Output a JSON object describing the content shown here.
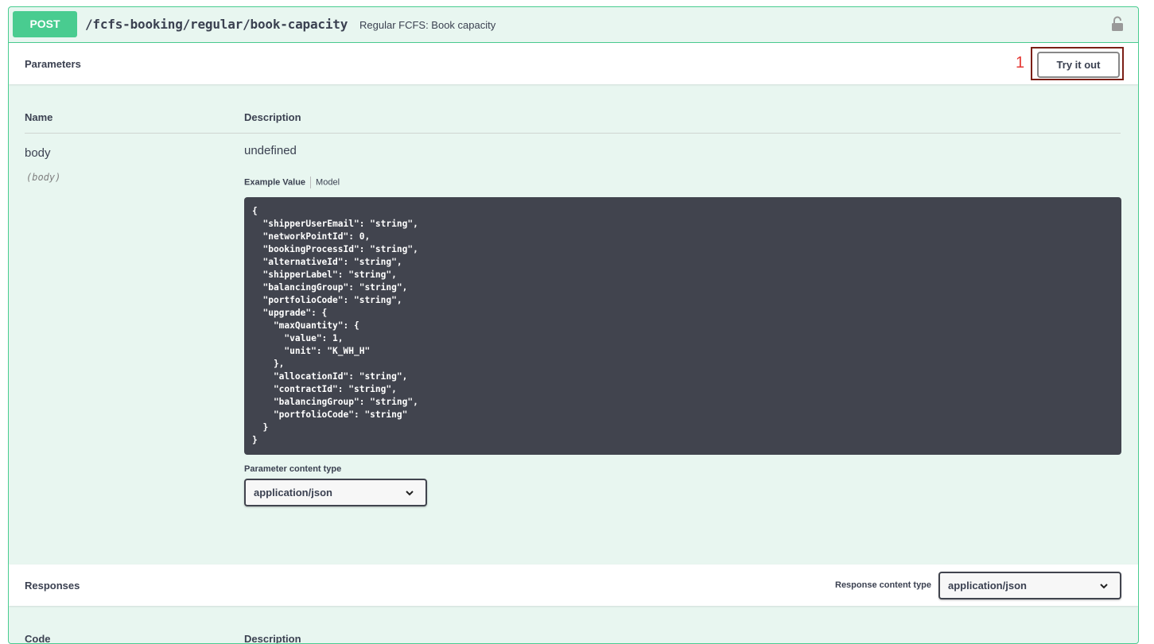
{
  "operation": {
    "method": "POST",
    "path": "/fcfs-booking/regular/book-capacity",
    "summary": "Regular FCFS: Book capacity",
    "lock_icon": "lock-open-icon"
  },
  "parameters": {
    "title": "Parameters",
    "annotation_number": "1",
    "try_it_out_label": "Try it out",
    "columns": {
      "name": "Name",
      "description": "Description"
    },
    "param": {
      "name": "body",
      "in": "(body)",
      "description": "undefined"
    },
    "tabs": {
      "example": "Example Value",
      "model": "Model"
    },
    "example_json": "{\n  \"shipperUserEmail\": \"string\",\n  \"networkPointId\": 0,\n  \"bookingProcessId\": \"string\",\n  \"alternativeId\": \"string\",\n  \"shipperLabel\": \"string\",\n  \"balancingGroup\": \"string\",\n  \"portfolioCode\": \"string\",\n  \"upgrade\": {\n    \"maxQuantity\": {\n      \"value\": 1,\n      \"unit\": \"K_WH_H\"\n    },\n    \"allocationId\": \"string\",\n    \"contractId\": \"string\",\n    \"balancingGroup\": \"string\",\n    \"portfolioCode\": \"string\"\n  }\n}",
    "content_type_label": "Parameter content type",
    "content_type_value": "application/json"
  },
  "responses": {
    "title": "Responses",
    "content_type_label": "Response content type",
    "content_type_value": "application/json",
    "columns": {
      "code": "Code",
      "description": "Description"
    }
  },
  "colors": {
    "accent": "#49cc90",
    "background": "#e8f6f0",
    "code_bg": "#41444e",
    "annotation": "#e53935"
  }
}
